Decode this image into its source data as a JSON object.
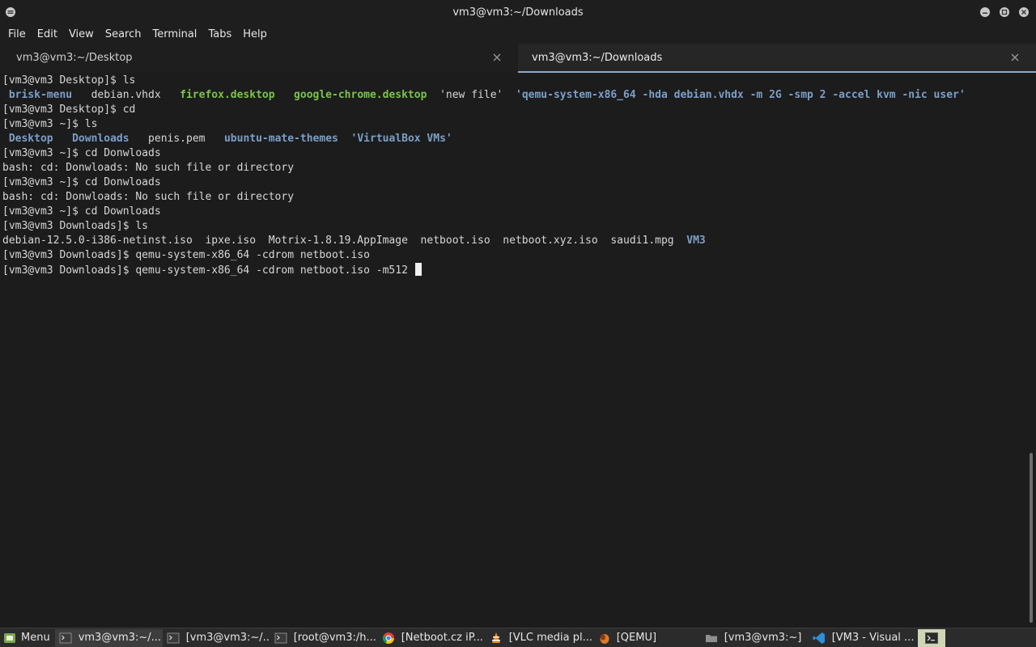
{
  "window": {
    "title": "vm3@vm3:~/Downloads",
    "buttons": [
      "minimize-icon",
      "maximize-icon",
      "close-icon"
    ]
  },
  "menubar": {
    "items": [
      "File",
      "Edit",
      "View",
      "Search",
      "Terminal",
      "Tabs",
      "Help"
    ]
  },
  "tabs": [
    {
      "label": "vm3@vm3:~/Desktop",
      "active": false
    },
    {
      "label": "vm3@vm3:~/Downloads",
      "active": true
    }
  ],
  "terminal": {
    "lines": [
      [
        {
          "t": "[vm3@vm3 Desktop]$ ls",
          "c": "plain"
        }
      ],
      [
        {
          "t": " brisk-menu",
          "c": "dir"
        },
        {
          "t": "   debian.vhdx   ",
          "c": "plain"
        },
        {
          "t": "firefox.desktop",
          "c": "exe"
        },
        {
          "t": "   ",
          "c": "plain"
        },
        {
          "t": "google-chrome.desktop",
          "c": "exe"
        },
        {
          "t": "  'new file'  ",
          "c": "plain"
        },
        {
          "t": "'qemu-system-x86_64 -hda debian.vhdx -m 2G -smp 2 -accel kvm -nic user'",
          "c": "dir"
        }
      ],
      [
        {
          "t": "[vm3@vm3 Desktop]$ cd",
          "c": "plain"
        }
      ],
      [
        {
          "t": "[vm3@vm3 ~]$ ls",
          "c": "plain"
        }
      ],
      [
        {
          "t": " Desktop",
          "c": "dir"
        },
        {
          "t": "   ",
          "c": "plain"
        },
        {
          "t": "Downloads",
          "c": "dir"
        },
        {
          "t": "   penis.pem   ",
          "c": "plain"
        },
        {
          "t": "ubuntu-mate-themes",
          "c": "dir"
        },
        {
          "t": "  ",
          "c": "plain"
        },
        {
          "t": "'VirtualBox VMs'",
          "c": "dir"
        }
      ],
      [
        {
          "t": "[vm3@vm3 ~]$ cd Donwloads",
          "c": "plain"
        }
      ],
      [
        {
          "t": "bash: cd: Donwloads: No such file or directory",
          "c": "plain"
        }
      ],
      [
        {
          "t": "[vm3@vm3 ~]$ cd Donwloads",
          "c": "plain"
        }
      ],
      [
        {
          "t": "bash: cd: Donwloads: No such file or directory",
          "c": "plain"
        }
      ],
      [
        {
          "t": "[vm3@vm3 ~]$ cd Downloads",
          "c": "plain"
        }
      ],
      [
        {
          "t": "[vm3@vm3 Downloads]$ ls",
          "c": "plain"
        }
      ],
      [
        {
          "t": "debian-12.5.0-i386-netinst.iso  ipxe.iso  Motrix-1.8.19.AppImage  netboot.iso  netboot.xyz.iso  saudi1.mpg  ",
          "c": "plain"
        },
        {
          "t": "VM3",
          "c": "dir"
        }
      ],
      [
        {
          "t": "[vm3@vm3 Downloads]$ qemu-system-x86_64 -cdrom netboot.iso",
          "c": "plain"
        }
      ],
      [
        {
          "t": "[vm3@vm3 Downloads]$ qemu-system-x86_64 -cdrom netboot.iso -m512 ",
          "c": "plain"
        }
      ]
    ],
    "colors": {
      "directory": "#7c9fc8",
      "executable": "#7cc34b",
      "text": "#d7d7d7",
      "background": "#1c1c1c"
    }
  },
  "taskbar": {
    "menu_label": "Menu",
    "items": [
      {
        "label": "vm3@vm3:~/...",
        "icon": "terminal-icon",
        "active": true
      },
      {
        "label": "[vm3@vm3:~/...",
        "icon": "terminal-icon",
        "active": false
      },
      {
        "label": "[root@vm3:/h...",
        "icon": "terminal-icon",
        "active": false
      },
      {
        "label": "[Netboot.cz iP...",
        "icon": "chrome-icon",
        "active": false
      },
      {
        "label": "[VLC media pl...",
        "icon": "vlc-icon",
        "active": false
      },
      {
        "label": "[QEMU]",
        "icon": "qemu-icon",
        "active": false
      },
      {
        "label": "[vm3@vm3:~]",
        "icon": "folder-icon",
        "active": false
      },
      {
        "label": "[VM3 - Visual ...",
        "icon": "vscode-icon",
        "active": false
      }
    ],
    "tray_icon": "terminal-launcher-icon"
  }
}
